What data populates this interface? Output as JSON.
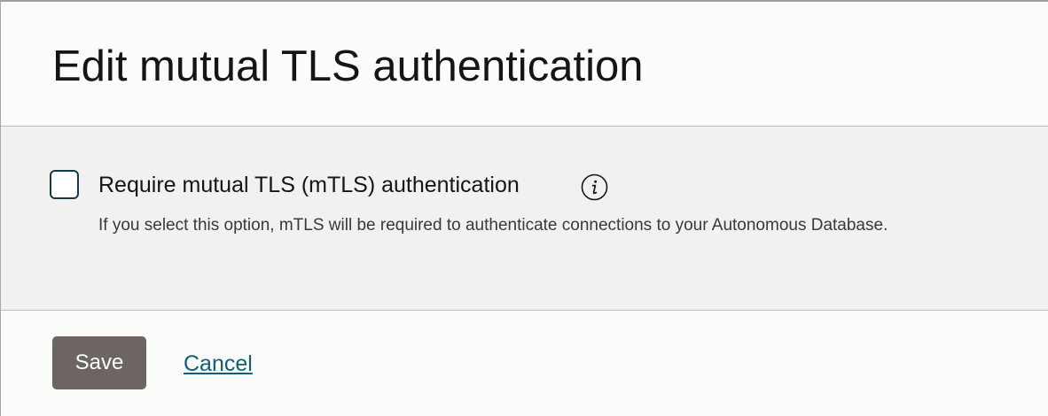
{
  "dialog": {
    "title": "Edit mutual TLS authentication"
  },
  "option": {
    "checkbox_label": "Require mutual TLS (mTLS) authentication",
    "checked": false,
    "info_icon": "info-icon",
    "help_text": "If you select this option, mTLS will be required to authenticate connections to your Autonomous Database."
  },
  "footer": {
    "save_label": "Save",
    "cancel_label": "Cancel"
  },
  "colors": {
    "checkbox_border": "#143a4a",
    "save_button": "#6c6561",
    "cancel_link": "#0f5f78",
    "body_background": "#f2f1f0"
  }
}
